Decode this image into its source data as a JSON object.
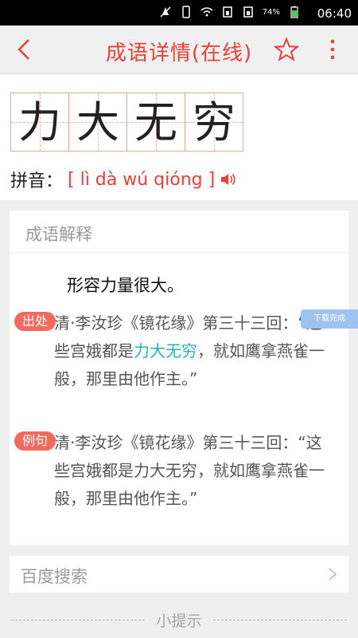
{
  "statusbar": {
    "battery": "74%",
    "time": "06:40",
    "icons": [
      "mute-icon",
      "phone-icon",
      "wifi-icon",
      "sim1-icon",
      "sim2-icon",
      "battery-icon"
    ]
  },
  "appbar": {
    "title": "成语详情(在线)",
    "back_icon": "back-icon",
    "star_icon": "star-icon",
    "more_icon": "more-icon"
  },
  "idiom": {
    "chars": [
      "力",
      "大",
      "无",
      "穷"
    ],
    "pinyin_label": "拼音：",
    "pinyin": "[ lì dà wú qióng ]"
  },
  "explain": {
    "section_title": "成语解释",
    "meaning": "形容力量很大。",
    "source_tag": "出处",
    "source_pre": "清·李汝珍《镜花缘》第三十三回：“这些宫娥都是",
    "source_hl": "力大无穷",
    "source_post": "，就如鹰拿燕雀一般，那里由他作主。”",
    "example_tag": "例句",
    "example_text": "清·李汝珍《镜花缘》第三十三回：“这些宫娥都是力大无穷，就如鹰拿燕雀一般，那里由他作主。”"
  },
  "toast": "下载完成",
  "baidu": {
    "label": "百度搜索"
  },
  "tip": {
    "label": "小提示"
  },
  "colors": {
    "accent": "#e9403a",
    "tag": "#f26a5e",
    "highlight": "#27b3b6"
  }
}
